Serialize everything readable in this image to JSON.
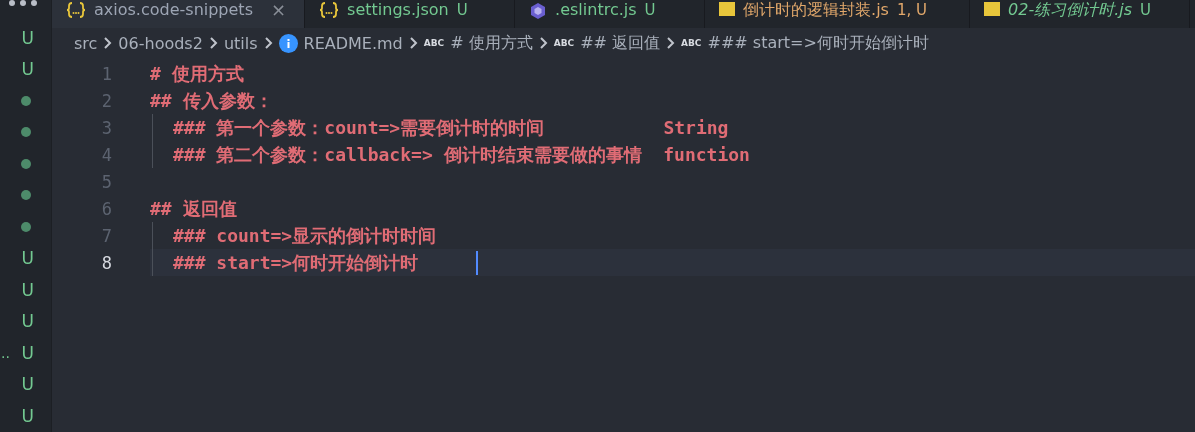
{
  "tabs": [
    {
      "kind": "braces",
      "label": "axios.code-snippets",
      "color": "#9da5b4",
      "preview": false,
      "selected": true,
      "close": "×"
    },
    {
      "kind": "braces",
      "label": "settings.json",
      "badge": "U",
      "color": "#73c991",
      "preview": false,
      "selected": false
    },
    {
      "kind": "eslint",
      "label": ".eslintrc.js",
      "badge": "U",
      "color": "#73c991",
      "preview": false,
      "selected": false
    },
    {
      "kind": "js",
      "label": "倒计时的逻辑封装.js",
      "badge": "1, U",
      "color": "#e2a86b",
      "preview": false,
      "selected": false
    },
    {
      "kind": "js",
      "label": "02-练习倒计时.js",
      "badge": "U",
      "color": "#73c991",
      "preview": true,
      "selected": false
    }
  ],
  "breadcrumb": [
    {
      "kind": "folder",
      "text": "src"
    },
    {
      "kind": "folder",
      "text": "06-hoods2"
    },
    {
      "kind": "folder",
      "text": "utils"
    },
    {
      "kind": "file",
      "text": "README.md"
    },
    {
      "kind": "symbol",
      "icon": "ABC",
      "text": "# 使用方式"
    },
    {
      "kind": "symbol",
      "icon": "ABC",
      "text": "## 返回值"
    },
    {
      "kind": "symbol",
      "icon": "ABC",
      "text": "### start=>何时开始倒计时"
    }
  ],
  "explorer": [
    {
      "kind": "untracked",
      "badge": "U"
    },
    {
      "kind": "untracked",
      "badge": "U"
    },
    {
      "kind": "modified"
    },
    {
      "kind": "modified"
    },
    {
      "kind": "modified"
    },
    {
      "kind": "modified"
    },
    {
      "kind": "modified"
    },
    {
      "kind": "untracked",
      "badge": "U"
    },
    {
      "kind": "untracked",
      "badge": "U"
    },
    {
      "kind": "untracked",
      "badge": "U"
    },
    {
      "kind": "untracked",
      "name": "..",
      "badge": "U"
    },
    {
      "kind": "untracked",
      "badge": "U"
    },
    {
      "kind": "untracked",
      "badge": "U"
    }
  ],
  "editor": {
    "lines": [
      {
        "number": "1",
        "text": "# 使用方式",
        "current": false
      },
      {
        "number": "2",
        "text": "## 传入参数：",
        "current": false,
        "children": [
          {
            "number": "3",
            "text": "### 第一个参数：count=>需要倒计时的时间           String",
            "current": false
          },
          {
            "number": "4",
            "text": "### 第二个参数：callback=> 倒计时结束需要做的事情  function",
            "current": false
          }
        ]
      },
      {
        "number": "5",
        "current": false
      },
      {
        "number": "6",
        "text": "## 返回值",
        "current": false,
        "children": [
          {
            "number": "7",
            "text": "### count=>显示的倒计时时间",
            "current": false
          },
          {
            "number": "8",
            "text": "### start=>何时开始倒计时",
            "current": true
          }
        ]
      }
    ]
  }
}
